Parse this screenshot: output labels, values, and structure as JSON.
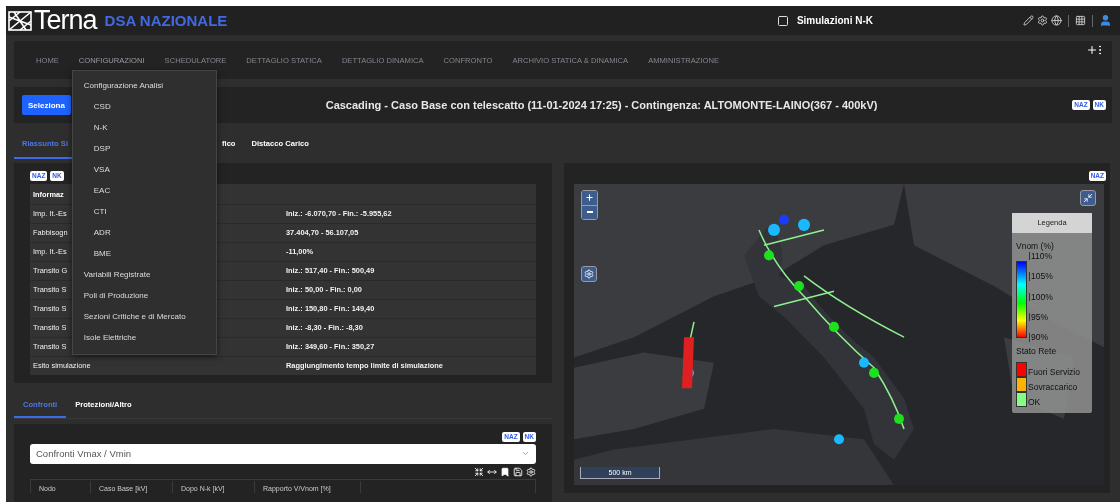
{
  "header": {
    "logo": "Terna",
    "app_title": "DSA NAZIONALE",
    "context": "Simulazioni N-K"
  },
  "nav": {
    "items": [
      {
        "label": "HOME",
        "expanded": false
      },
      {
        "label": "CONFIGURAZIONI",
        "expanded": true
      },
      {
        "label": "SCHEDULATORE",
        "expanded": false
      },
      {
        "label": "DETTAGLIO STATICA",
        "expanded": false
      },
      {
        "label": "DETTAGLIO DINAMICA",
        "expanded": false
      },
      {
        "label": "CONFRONTO",
        "expanded": false
      },
      {
        "label": "ARCHIVIO STATICA & DINAMICA",
        "expanded": false
      },
      {
        "label": "AMMINISTRAZIONE",
        "expanded": false
      }
    ],
    "dropdown": [
      {
        "label": "Configurazione Analisi",
        "kind": "header"
      },
      {
        "label": "CSD",
        "kind": "sub"
      },
      {
        "label": "N-K",
        "kind": "sub"
      },
      {
        "label": "DSP",
        "kind": "sub"
      },
      {
        "label": "VSA",
        "kind": "sub"
      },
      {
        "label": "EAC",
        "kind": "sub"
      },
      {
        "label": "CTI",
        "kind": "sub"
      },
      {
        "label": "ADR",
        "kind": "sub"
      },
      {
        "label": "BME",
        "kind": "sub"
      },
      {
        "label": "Variabili Registrate",
        "kind": "header"
      },
      {
        "label": "Poli di Produzione",
        "kind": "header"
      },
      {
        "label": "Sezioni Critiche e di Mercato",
        "kind": "header"
      },
      {
        "label": "Isole Elettriche",
        "kind": "header"
      }
    ]
  },
  "title_bar": {
    "button": "Seleziona",
    "title": "Cascading - Caso Base con telescatto (11-01-2024 17:25) - Contingenza: ALTOMONTE-LAINO(367 - 400kV)",
    "badges": [
      "NAZ",
      "NK"
    ]
  },
  "result_tabs": [
    {
      "label": "Riassunto Si",
      "selected": true
    },
    {
      "label": "fico",
      "selected": false
    },
    {
      "label": "Distacco Carico",
      "selected": false
    }
  ],
  "summary": {
    "badges": [
      "NAZ",
      "NK"
    ],
    "header": "Informaz",
    "rows": [
      {
        "label": "Imp. It.-Es",
        "value": "Iniz.: -6.070,70 - Fin.: -5.955,62"
      },
      {
        "label": "Fabbisogn",
        "value": "37.404,70 - 56.107,05"
      },
      {
        "label": "Imp. It.-Es",
        "value": "-11,00%"
      },
      {
        "label": "Transito G",
        "value": "Iniz.: 517,40 - Fin.: 500,49"
      },
      {
        "label": "Transito S",
        "value": "Iniz.: 50,00 - Fin.: 0,00"
      },
      {
        "label": "Transito S",
        "value": "Iniz.: 150,80 - Fin.: 149,40"
      },
      {
        "label": "Transito S",
        "value": "Iniz.: -8,30 - Fin.: -8,30"
      },
      {
        "label": "Transito S",
        "value": "Iniz.: 349,60 - Fin.: 350,27"
      },
      {
        "label": "Esito simulazione",
        "value": "Raggiungimento tempo limite di simulazione"
      }
    ]
  },
  "map": {
    "badge": "NAZ",
    "scale": "500 km",
    "legend": {
      "title": "Legenda",
      "scale_title": "Vnom (%)",
      "ticks": [
        "110%",
        "105%",
        "100%",
        "95%",
        "90%"
      ],
      "state_title": "Stato Rete",
      "states": [
        {
          "label": "Fuori Servizio",
          "color": "#ff0000"
        },
        {
          "label": "Sovraccarico",
          "color": "#ffb300"
        },
        {
          "label": "OK",
          "color": "#80ff80"
        }
      ]
    }
  },
  "compare": {
    "tabs": [
      {
        "label": "Confronti",
        "selected": true
      },
      {
        "label": "Protezioni/Altro",
        "selected": false
      }
    ],
    "badges": [
      "NAZ",
      "NK"
    ],
    "select": "Confronti Vmax / Vmin",
    "columns": [
      "Nodo",
      "Caso Base [kV]",
      "Dopo N-k [kV]",
      "Rapporto V/Vnom [%]"
    ]
  }
}
